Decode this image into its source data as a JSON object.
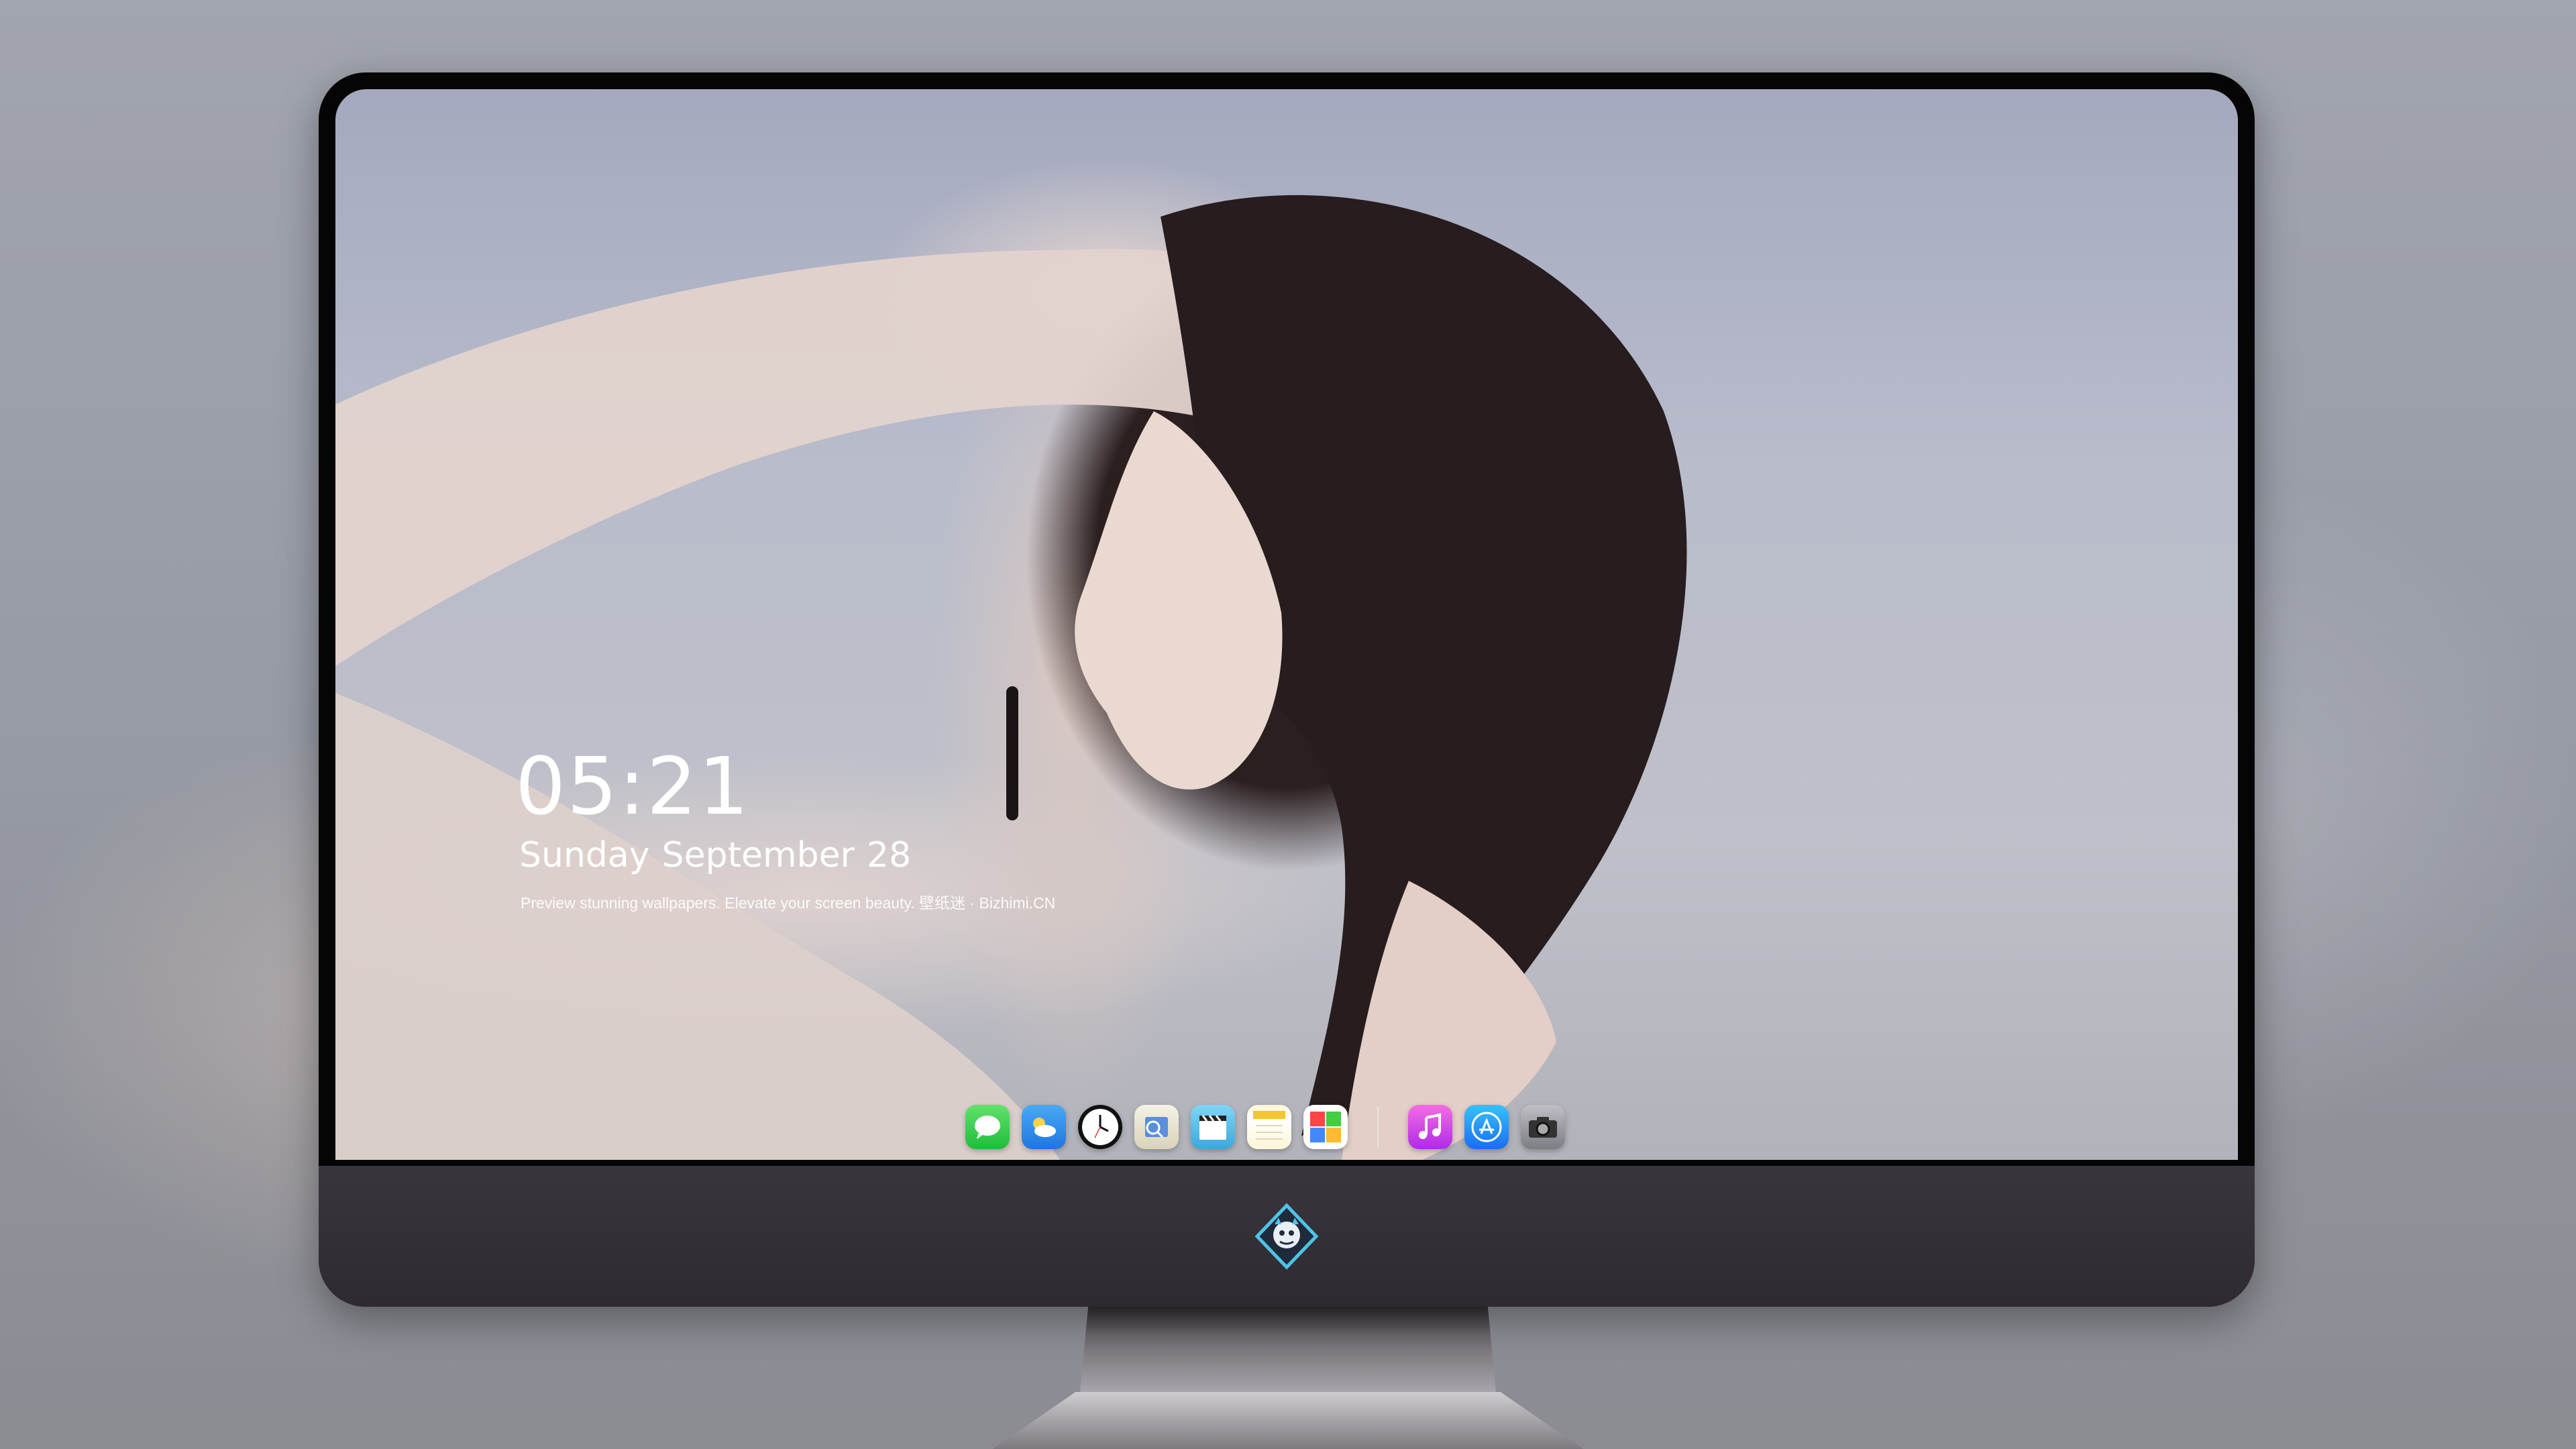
{
  "desktop": {
    "time": "05:21",
    "date": {
      "weekday": "Sunday",
      "month": "September",
      "day": "28"
    },
    "tagline": "Preview stunning wallpapers. Elevate your screen beauty. 壁纸迷 · Bizhimi.CN"
  },
  "dock": {
    "items": [
      {
        "name": "messages-icon"
      },
      {
        "name": "weather-icon"
      },
      {
        "name": "clock-icon"
      },
      {
        "name": "preview-icon"
      },
      {
        "name": "clips-icon"
      },
      {
        "name": "notes-icon"
      },
      {
        "name": "photos-icon"
      },
      {
        "name": "music-icon"
      },
      {
        "name": "app-store-icon"
      },
      {
        "name": "camera-icon"
      }
    ]
  },
  "colors": {
    "monitor_bezel": "#050506",
    "monitor_chin": "#2f2a31",
    "text": "#ffffff"
  }
}
